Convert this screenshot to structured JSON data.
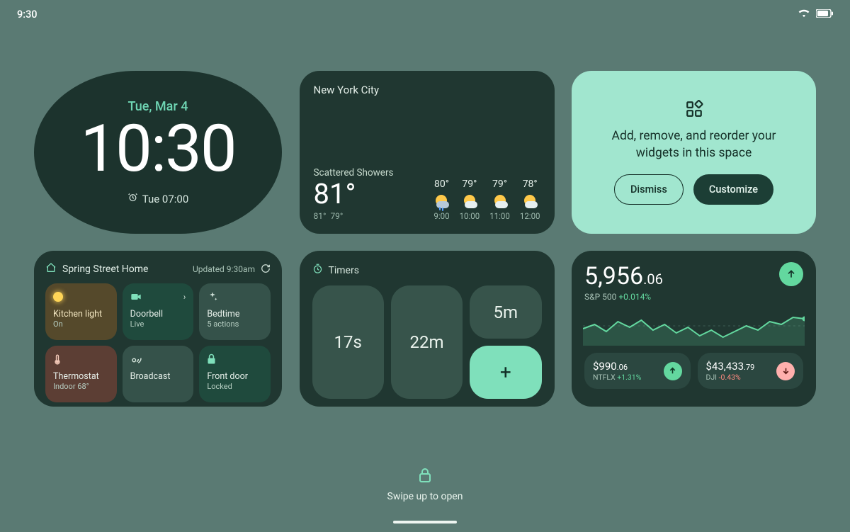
{
  "status": {
    "time": "9:30"
  },
  "clock": {
    "date": "Tue, Mar 4",
    "time": "10:30",
    "alarm": "Tue 07:00"
  },
  "weather": {
    "city": "New York City",
    "condition": "Scattered Showers",
    "temp": "81°",
    "hi": "81°",
    "lo": "79°",
    "forecast": [
      {
        "temp": "80°",
        "time": "9:00",
        "icon": "rain"
      },
      {
        "temp": "79°",
        "time": "10:00",
        "icon": "partly"
      },
      {
        "temp": "79°",
        "time": "11:00",
        "icon": "partly"
      },
      {
        "temp": "78°",
        "time": "12:00",
        "icon": "partly"
      }
    ]
  },
  "promo": {
    "text": "Add, remove, and reorder your widgets in this space",
    "dismiss": "Dismiss",
    "customize": "Customize"
  },
  "home": {
    "name": "Spring Street Home",
    "updated": "Updated 9:30am",
    "tiles": [
      {
        "title": "Kitchen light",
        "sub": "On"
      },
      {
        "title": "Doorbell",
        "sub": "Live"
      },
      {
        "title": "Bedtime",
        "sub": "5 actions"
      },
      {
        "title": "Thermostat",
        "sub": "Indoor 68°"
      },
      {
        "title": "Broadcast",
        "sub": ""
      },
      {
        "title": "Front door",
        "sub": "Locked"
      }
    ]
  },
  "timers": {
    "label": "Timers",
    "items": [
      "17s",
      "22m",
      "5m"
    ],
    "add": "+"
  },
  "stocks": {
    "main_int": "5,956",
    "main_dec": ".06",
    "main_label": "S&P 500",
    "main_change": "+0.014%",
    "minis": [
      {
        "price_int": "$990",
        "price_dec": ".06",
        "sym": "NTFLX",
        "change": "+1.31%",
        "dir": "up"
      },
      {
        "price_int": "$43,433",
        "price_dec": ".79",
        "sym": "DJI",
        "change": "-0.43%",
        "dir": "down"
      }
    ]
  },
  "lock": {
    "hint": "Swipe up to open"
  },
  "chart_data": {
    "type": "line",
    "title": "S&P 500 intraday",
    "x": [
      0,
      1,
      2,
      3,
      4,
      5,
      6,
      7,
      8,
      9,
      10,
      11,
      12,
      13,
      14,
      15,
      16,
      17,
      18,
      19
    ],
    "values": [
      24,
      30,
      20,
      34,
      26,
      36,
      22,
      30,
      18,
      26,
      14,
      22,
      12,
      20,
      28,
      22,
      34,
      30,
      40,
      38
    ],
    "ylim": [
      0,
      56
    ]
  }
}
